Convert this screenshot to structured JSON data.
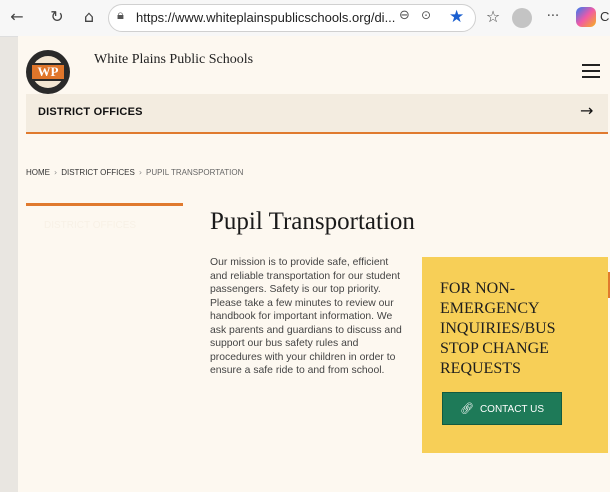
{
  "browser": {
    "url": "https://www.whiteplainspublicschools.org/di...",
    "copilot_label": "C"
  },
  "icons": {
    "back": "arrow-left-icon",
    "refresh": "refresh-icon",
    "home": "home-icon",
    "lock": "lock-icon",
    "zoom": "zoom-icon",
    "more": "more-icon",
    "favorite": "star-icon",
    "favorites_list": "favorites-icon",
    "profile": "profile-icon",
    "settings": "ellipsis-icon",
    "copilot": "copilot-icon",
    "menu": "hamburger-icon",
    "district_arrow": "arrow-right-icon",
    "contact_link": "link-icon"
  },
  "site": {
    "name": "White Plains Public Schools",
    "logo_text": "WP"
  },
  "district_bar": {
    "label": "DISTRICT OFFICES"
  },
  "breadcrumb": {
    "home": "HOME",
    "section": "DISTRICT OFFICES",
    "current": "PUPIL TRANSPORTATION"
  },
  "sidebar": {
    "ghost_label": "DISTRICT OFFICES"
  },
  "main": {
    "title": "Pupil Transportation",
    "mission": "Our mission is to provide safe, efficient and reliable transportation for our student passengers.  Safety is our top priority.  Please take a few minutes to review our handbook for important information. We ask parents and guardians to discuss and support our bus safety rules and procedures with your children in order to ensure a safe ride to and from school."
  },
  "contact": {
    "heading": "FOR NON-EMERGENCY INQUIRIES/BUS STOP CHANGE REQUESTS",
    "button_label": "CONTACT US"
  },
  "colors": {
    "accent_orange": "#e07a2e",
    "contact_yellow": "#f7cf57",
    "button_green": "#1e7a58",
    "page_bg": "#fdf8f0"
  }
}
